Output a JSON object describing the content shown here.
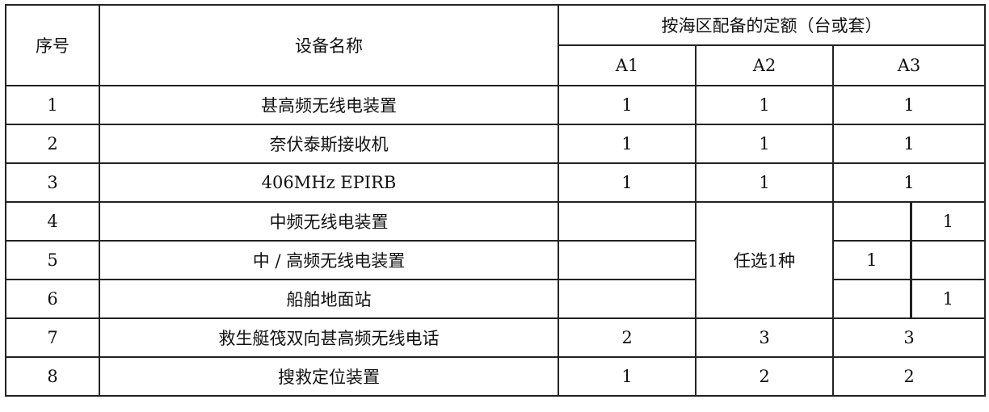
{
  "headers": {
    "seq": "序号",
    "name": "设备名称",
    "quota": "按海区配备的定额（台或套）",
    "a1": "A1",
    "a2": "A2",
    "a3": "A3"
  },
  "rows": [
    {
      "seq": "1",
      "name": "甚高频无线电装置",
      "a1": "1",
      "a2": "1",
      "a3": "1"
    },
    {
      "seq": "2",
      "name": "奈伏泰斯接收机",
      "a1": "1",
      "a2": "1",
      "a3": "1"
    },
    {
      "seq": "3",
      "name": "406MHz EPIRB",
      "a1": "1",
      "a2": "1",
      "a3": "1"
    },
    {
      "seq": "4",
      "name": "中频无线电装置",
      "a1": "",
      "a3_left": "",
      "a3_right": "1"
    },
    {
      "seq": "5",
      "name": "中 / 高频无线电装置",
      "a1": "",
      "a3_left": "1",
      "a3_right": ""
    },
    {
      "seq": "6",
      "name": "船舶地面站",
      "a1": "",
      "a3_left": "",
      "a3_right": "1"
    },
    {
      "seq": "7",
      "name": "救生艇筏双向甚高频无线电话",
      "a1": "2",
      "a2": "3",
      "a3": "3"
    },
    {
      "seq": "8",
      "name": "搜救定位装置",
      "a1": "1",
      "a2": "2",
      "a3": "2"
    }
  ],
  "merged": {
    "a2_rows_4_6": "任选1种"
  }
}
